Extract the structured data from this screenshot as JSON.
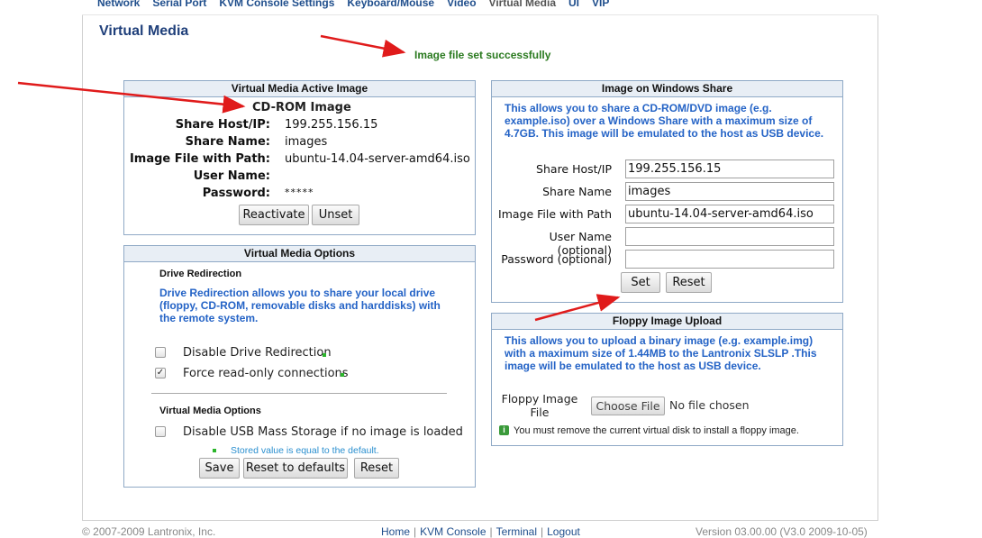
{
  "nav": {
    "items": [
      "Network",
      "Serial Port",
      "KVM Console Settings",
      "Keyboard/Mouse",
      "Video",
      "Virtual Media",
      "UI",
      "VIP"
    ],
    "active_index": 5
  },
  "page_title": "Virtual Media",
  "status_message": "Image file set successfully",
  "active_image": {
    "header": "Virtual Media Active Image",
    "type": "CD-ROM Image",
    "share_host_label": "Share Host/IP:",
    "share_host": "199.255.156.15",
    "share_name_label": "Share Name:",
    "share_name": "images",
    "image_file_label": "Image File with Path:",
    "image_file": "ubuntu-14.04-server-amd64.iso",
    "user_name_label": "User Name:",
    "user_name": "",
    "password_label": "Password:",
    "password": "*****",
    "reactivate_label": "Reactivate",
    "unset_label": "Unset"
  },
  "options": {
    "header": "Virtual Media Options",
    "drive_redirection_title": "Drive Redirection",
    "drive_redirection_desc": "Drive Redirection allows you to share your local drive (floppy, CD-ROM, removable disks and harddisks) with the remote system.",
    "disable_redirection_label": "Disable Drive Redirection",
    "disable_redirection_checked": false,
    "force_readonly_label": "Force read-only connections",
    "force_readonly_checked": true,
    "vm_options_title": "Virtual Media Options",
    "disable_usb_label": "Disable USB Mass Storage if no image is loaded",
    "disable_usb_checked": false,
    "default_note": "Stored value is equal to the default.",
    "save_label": "Save",
    "reset_defaults_label": "Reset to defaults",
    "reset_label": "Reset"
  },
  "windows_share": {
    "header": "Image on Windows Share",
    "desc": "This allows you to share a CD-ROM/DVD image (e.g. example.iso) over a Windows Share with a maximum size of 4.7GB. This image will be emulated to the host as USB device.",
    "share_host_label": "Share Host/IP",
    "share_host": "199.255.156.15",
    "share_name_label": "Share Name",
    "share_name": "images",
    "image_file_label": "Image File with Path",
    "image_file": "ubuntu-14.04-server-amd64.iso",
    "user_name_label": "User Name (optional)",
    "user_name": "",
    "password_label": "Password (optional)",
    "password": "",
    "set_label": "Set",
    "reset_label": "Reset"
  },
  "floppy": {
    "header": "Floppy Image Upload",
    "desc": "This allows you to upload a binary image (e.g. example.img) with a maximum size of 1.44MB to the Lantronix SLSLP .This image will be emulated to the host as USB device.",
    "file_label_line1": "Floppy Image",
    "file_label_line2": "File",
    "choose_file_label": "Choose File",
    "no_file_text": "No file chosen",
    "info_text": "You must remove the current virtual disk to install a floppy image."
  },
  "footer": {
    "copyright": "© 2007-2009 Lantronix, Inc.",
    "links": [
      "Home",
      "KVM Console",
      "Terminal",
      "Logout"
    ],
    "version": "Version 03.00.00 (V3.0  2009-10-05)"
  },
  "colors": {
    "link": "#1f4e8c",
    "panel_border": "#8fa9c6",
    "desc_blue": "#2463c6",
    "success_green": "#2a7a1f",
    "arrow_red": "#e01b1b"
  }
}
